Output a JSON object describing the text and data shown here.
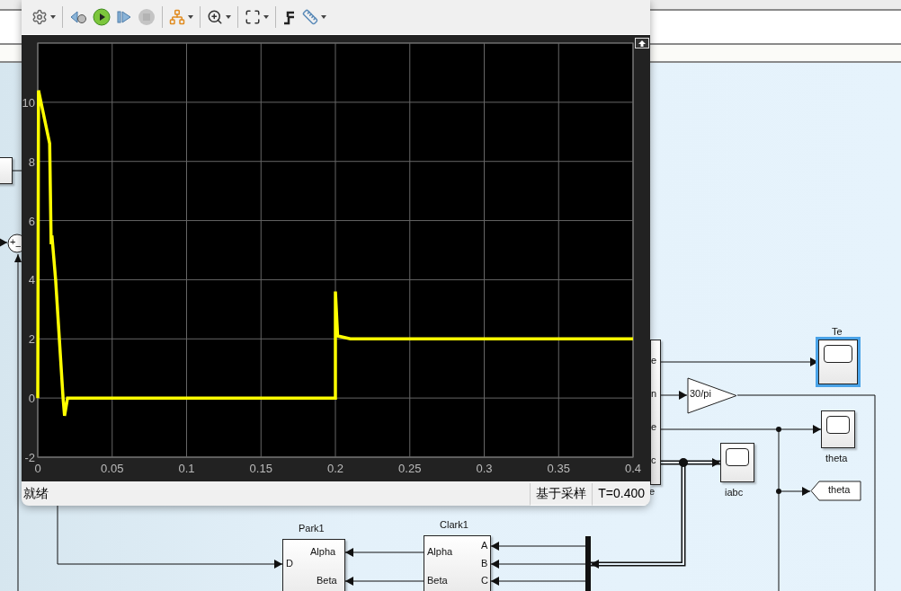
{
  "scope_window": {
    "toolbar": [
      [
        {
          "kind": "settings",
          "dropdown": true,
          "disabled": false
        }
      ],
      [
        {
          "kind": "step_back",
          "dropdown": false,
          "disabled": false
        },
        {
          "kind": "run",
          "dropdown": false,
          "disabled": false
        },
        {
          "kind": "step_forward",
          "dropdown": false,
          "disabled": false
        },
        {
          "kind": "stop",
          "dropdown": false,
          "disabled": true
        }
      ],
      [
        {
          "kind": "highlight",
          "dropdown": true,
          "disabled": false
        }
      ],
      [
        {
          "kind": "zoom",
          "dropdown": true,
          "disabled": false
        }
      ],
      [
        {
          "kind": "fit",
          "dropdown": true,
          "disabled": false
        }
      ],
      [
        {
          "kind": "signal",
          "dropdown": false,
          "disabled": false
        },
        {
          "kind": "measure",
          "dropdown": true,
          "disabled": false
        }
      ]
    ],
    "plot": {
      "chart_data": {
        "type": "line",
        "grid": true,
        "xlim": [
          0,
          0.4
        ],
        "ylim": [
          -2,
          12
        ],
        "xticks": [
          {
            "value": 0,
            "label": "0"
          },
          {
            "value": 0.05,
            "label": "0.05"
          },
          {
            "value": 0.1,
            "label": "0.1"
          },
          {
            "value": 0.15,
            "label": "0.15"
          },
          {
            "value": 0.2,
            "label": "0.2"
          },
          {
            "value": 0.25,
            "label": "0.25"
          },
          {
            "value": 0.3,
            "label": "0.3"
          },
          {
            "value": 0.35,
            "label": "0.35"
          },
          {
            "value": 0.4,
            "label": "0.4"
          }
        ],
        "yticks": [
          {
            "value": -2,
            "label": "-2"
          },
          {
            "value": 0,
            "label": "0"
          },
          {
            "value": 2,
            "label": "2"
          },
          {
            "value": 4,
            "label": "4"
          },
          {
            "value": 6,
            "label": "6"
          },
          {
            "value": 8,
            "label": "8"
          },
          {
            "value": 10,
            "label": "10"
          }
        ],
        "series": [
          {
            "color": "#ffff00",
            "x": [
              0,
              0.0005,
              0.008,
              0.009,
              0.0095,
              0.012,
              0.017,
              0.018,
              0.02,
              0.2,
              0.2,
              0.2015,
              0.21,
              0.4
            ],
            "values": [
              0,
              10.4,
              8.6,
              5.2,
              5.5,
              4,
              0,
              -0.6,
              0,
              0,
              3.6,
              2.1,
              2,
              2
            ]
          }
        ]
      }
    },
    "status_bar": {
      "message": "就绪",
      "mode": "基于采样",
      "time": "T=0.400"
    }
  },
  "diagram": {
    "blocks": [
      {
        "kind": "box",
        "selected": false
      },
      {
        "kind": "sum",
        "selected": false,
        "signs": [
          "+",
          "−"
        ]
      },
      {
        "kind": "subsystem",
        "selected": false,
        "name": "e",
        "right_ports": [
          "e",
          "n",
          "e",
          "c"
        ]
      },
      {
        "kind": "scope",
        "selected": true,
        "name": "Te"
      },
      {
        "kind": "gain",
        "selected": false,
        "value": "30/pi"
      },
      {
        "kind": "scope",
        "selected": false,
        "name": "theta"
      },
      {
        "kind": "scope",
        "selected": false,
        "name": "iabc"
      },
      {
        "kind": "goto",
        "selected": false,
        "value": "theta"
      },
      {
        "kind": "block",
        "selected": false,
        "name": "Park1",
        "left_ports": [
          "D"
        ],
        "right_ports": [
          "Alpha",
          "Beta"
        ]
      },
      {
        "kind": "block",
        "selected": false,
        "name": "Clark1",
        "left_ports": [
          "Alpha",
          "Beta"
        ],
        "right_ports": [
          "A",
          "B",
          "C"
        ]
      },
      {
        "kind": "bus",
        "selected": false
      }
    ]
  }
}
